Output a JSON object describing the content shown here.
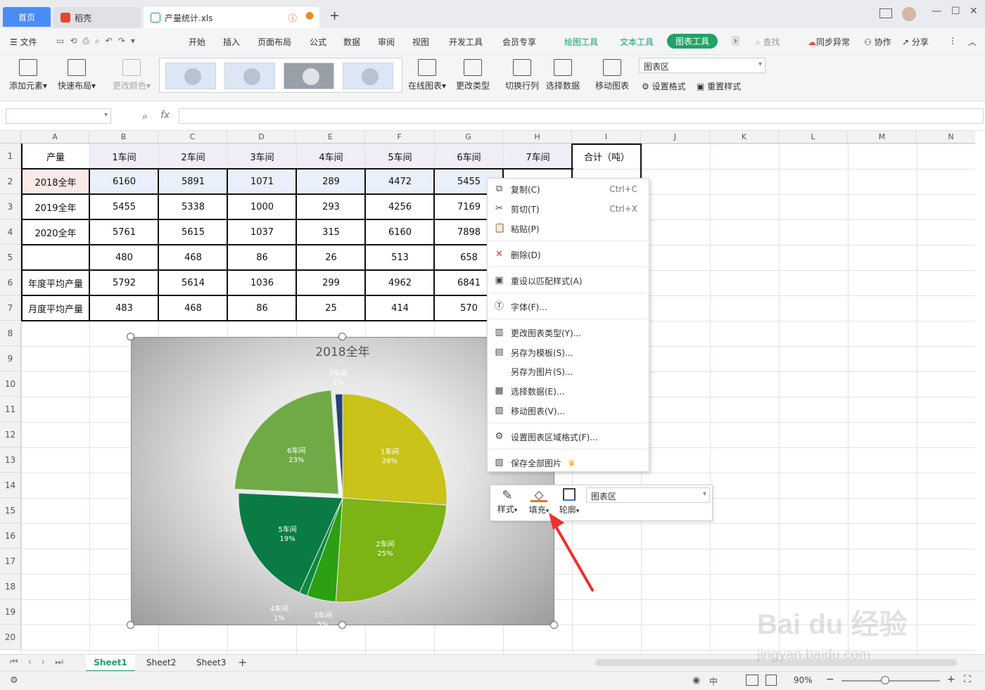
{
  "titlebar": {
    "tabs": [
      {
        "label": "首页"
      },
      {
        "label": "稻壳"
      },
      {
        "label": "产量统计.xls"
      }
    ],
    "new_tab": "+"
  },
  "menubar": {
    "file": "文件",
    "items": [
      "开始",
      "插入",
      "页面布局",
      "公式",
      "数据",
      "审阅",
      "视图",
      "开发工具",
      "会员专享"
    ],
    "context_tabs": [
      "绘图工具",
      "文本工具"
    ],
    "active_tab": "图表工具",
    "overflow": "›",
    "search": "查找",
    "sync": "同步异常",
    "collab": "协作",
    "share": "分享"
  },
  "ribbon": {
    "add_element": "添加元素",
    "quick_layout": "快速布局",
    "change_color": "更改颜色",
    "online_chart": "在线图表",
    "change_type": "更改类型",
    "switch_rowcol": "切换行列",
    "select_data": "选择数据",
    "move_chart": "移动图表",
    "area_select": "图表区",
    "set_format": "设置格式",
    "reset_style": "重置样式"
  },
  "formulabar": {
    "fx": "fx",
    "value": ""
  },
  "columns": [
    "A",
    "B",
    "C",
    "D",
    "E",
    "F",
    "G",
    "H",
    "I",
    "J",
    "K",
    "L",
    "M",
    "N"
  ],
  "rows": [
    "1",
    "2",
    "3",
    "4",
    "5",
    "6",
    "7",
    "8",
    "9",
    "10",
    "11",
    "12",
    "13",
    "14",
    "15",
    "16",
    "17",
    "18",
    "19",
    "20"
  ],
  "table": {
    "header": [
      "产量",
      "1车间",
      "2车间",
      "3车间",
      "4车间",
      "5车间",
      "6车间",
      "7车间",
      "合计（吨）"
    ],
    "rows": [
      [
        "2018全年",
        "6160",
        "5891",
        "1071",
        "289",
        "4472",
        "5455"
      ],
      [
        "2019全年",
        "5455",
        "5338",
        "1000",
        "293",
        "4256",
        "7169"
      ],
      [
        "2020全年",
        "5761",
        "5615",
        "1037",
        "315",
        "6160",
        "7898"
      ],
      [
        "",
        "480",
        "468",
        "86",
        "26",
        "513",
        "658"
      ],
      [
        "年度平均产量",
        "5792",
        "5614",
        "1036",
        "299",
        "4962",
        "6841"
      ],
      [
        "月度平均产量",
        "483",
        "468",
        "86",
        "25",
        "414",
        "570"
      ]
    ]
  },
  "chart_data": {
    "type": "pie",
    "title": "2018全年",
    "categories": [
      "1车间",
      "2车间",
      "3车间",
      "4车间",
      "5车间",
      "6车间",
      "7车间"
    ],
    "values": [
      6160,
      5891,
      1071,
      289,
      4472,
      5455,
      269
    ],
    "percent_labels": [
      "26%",
      "25%",
      "5%",
      "1%",
      "19%",
      "23%",
      "1%"
    ],
    "colors": [
      "#c9c31a",
      "#7bb414",
      "#2c9f13",
      "#0a8a3e",
      "#0a7b44",
      "#70aa46",
      "#24407c"
    ]
  },
  "context_menu": {
    "items": [
      {
        "label": "复制(C)",
        "shortcut": "Ctrl+C",
        "icon": "copy-icon"
      },
      {
        "label": "剪切(T)",
        "shortcut": "Ctrl+X",
        "icon": "cut-icon"
      },
      {
        "label": "粘贴(P)",
        "shortcut": "",
        "icon": "paste-icon"
      },
      {
        "label": "删除(D)",
        "shortcut": "",
        "icon": "delete-icon"
      },
      {
        "label": "重设以匹配样式(A)",
        "shortcut": "",
        "icon": "reset-style-icon"
      },
      {
        "label": "字体(F)...",
        "shortcut": "",
        "icon": "font-icon"
      },
      {
        "label": "更改图表类型(Y)...",
        "shortcut": "",
        "icon": "chart-type-icon"
      },
      {
        "label": "另存为模板(S)...",
        "shortcut": "",
        "icon": "save-template-icon"
      },
      {
        "label": "另存为图片(S)...",
        "shortcut": "",
        "icon": ""
      },
      {
        "label": "选择数据(E)...",
        "shortcut": "",
        "icon": "select-data-icon"
      },
      {
        "label": "移动图表(V)...",
        "shortcut": "",
        "icon": "move-chart-icon"
      },
      {
        "label": "设置图表区域格式(F)...",
        "shortcut": "",
        "icon": "format-area-icon"
      },
      {
        "label": "保存全部图片",
        "shortcut": "",
        "icon": "save-images-icon"
      }
    ]
  },
  "mini_toolbar": {
    "style": "样式",
    "fill": "填充",
    "outline": "轮廓",
    "area": "图表区"
  },
  "sheets": [
    "Sheet1",
    "Sheet2",
    "Sheet3"
  ],
  "statusbar": {
    "zoom": "90%",
    "lang": "中"
  },
  "watermark": {
    "brand": "Bai du 经验",
    "url": "jingyan.baidu.com"
  }
}
